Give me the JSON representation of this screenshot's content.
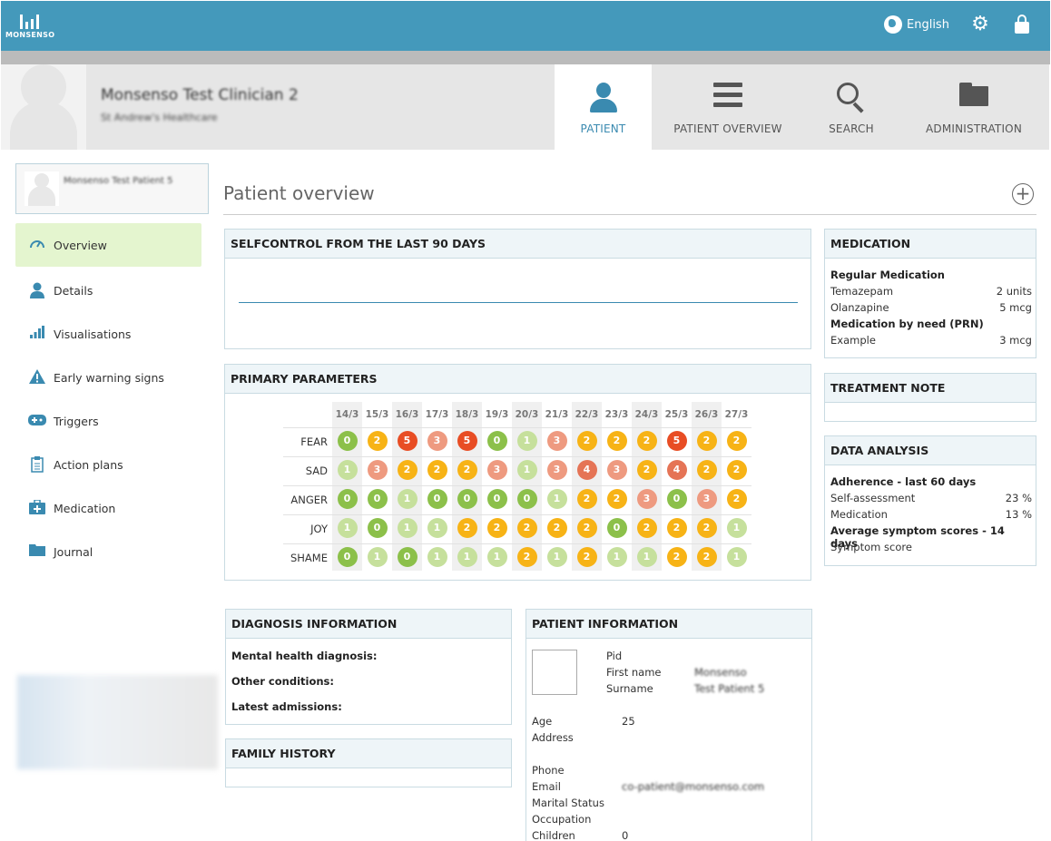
{
  "app": {
    "brand": "MONSENSO",
    "language": "English"
  },
  "header": {
    "clinician_name": "Monsenso Test Clinician 2",
    "clinician_org": "St Andrew's Healthcare"
  },
  "nav": {
    "tabs": [
      "PATIENT",
      "PATIENT OVERVIEW",
      "SEARCH",
      "ADMINISTRATION"
    ],
    "active": "PATIENT"
  },
  "patient_card": {
    "name": "Monsenso Test Patient 5"
  },
  "sidebar": {
    "items": [
      "Overview",
      "Details",
      "Visualisations",
      "Early warning signs",
      "Triggers",
      "Action plans",
      "Medication",
      "Journal"
    ],
    "active": "Overview"
  },
  "page": {
    "title": "Patient overview",
    "add_symbol": "+"
  },
  "selfcontrol": {
    "title": "SELFCONTROL FROM THE LAST 90 DAYS"
  },
  "primary": {
    "title": "PRIMARY PARAMETERS",
    "dates": [
      "14/3",
      "15/3",
      "16/3",
      "17/3",
      "18/3",
      "19/3",
      "20/3",
      "21/3",
      "22/3",
      "23/3",
      "24/3",
      "25/3",
      "26/3",
      "27/3"
    ],
    "rows": [
      {
        "label": "FEAR",
        "values": [
          0,
          2,
          5,
          3,
          5,
          0,
          1,
          3,
          2,
          2,
          2,
          5,
          2,
          2
        ]
      },
      {
        "label": "SAD",
        "values": [
          1,
          3,
          2,
          2,
          2,
          3,
          1,
          3,
          4,
          3,
          2,
          4,
          2,
          2
        ]
      },
      {
        "label": "ANGER",
        "values": [
          0,
          0,
          1,
          0,
          0,
          0,
          0,
          1,
          2,
          2,
          3,
          0,
          3,
          2
        ]
      },
      {
        "label": "JOY",
        "values": [
          1,
          0,
          1,
          1,
          2,
          2,
          2,
          2,
          2,
          0,
          2,
          2,
          2,
          1
        ]
      },
      {
        "label": "SHAME",
        "values": [
          0,
          1,
          0,
          1,
          1,
          1,
          2,
          1,
          2,
          1,
          1,
          2,
          2,
          1
        ]
      }
    ],
    "level_colors": {
      "0": "#8cc04a",
      "1": "#c6e09c",
      "2": "#f7b316",
      "3": "#ee9a80",
      "4": "#e57456",
      "5": "#e84d24"
    }
  },
  "medication": {
    "title": "MEDICATION",
    "regular_heading": "Regular Medication",
    "regular": [
      {
        "name": "Temazepam",
        "dose": "2 units"
      },
      {
        "name": "Olanzapine",
        "dose": "5 mcg"
      }
    ],
    "prn_heading": "Medication by need (PRN)",
    "prn": [
      {
        "name": "Example",
        "dose": "3 mcg"
      }
    ]
  },
  "treatment": {
    "title": "TREATMENT NOTE"
  },
  "analysis": {
    "title": "DATA ANALYSIS",
    "adherence_heading": "Adherence - last 60 days",
    "adherence": [
      {
        "name": "Self-assessment",
        "value": "23 %"
      },
      {
        "name": "Medication",
        "value": "13 %"
      }
    ],
    "symptom_heading": "Average symptom scores - 14 days",
    "symptom_label": "Symptom score"
  },
  "diagnosis": {
    "title": "DIAGNOSIS INFORMATION",
    "lines": [
      "Mental health diagnosis:",
      "Other conditions:",
      "Latest admissions:"
    ]
  },
  "family": {
    "title": "FAMILY HISTORY"
  },
  "patinfo": {
    "title": "PATIENT INFORMATION",
    "pid_label": "Pid",
    "firstname_label": "First name",
    "firstname_value": "Monsenso",
    "surname_label": "Surname",
    "surname_value": "Test Patient 5",
    "age_label": "Age",
    "age_value": "25",
    "address_label": "Address",
    "phone_label": "Phone",
    "email_label": "Email",
    "email_value": "co-patient@monsenso.com",
    "marital_label": "Marital Status",
    "occupation_label": "Occupation",
    "children_label": "Children",
    "children_value": "0"
  }
}
